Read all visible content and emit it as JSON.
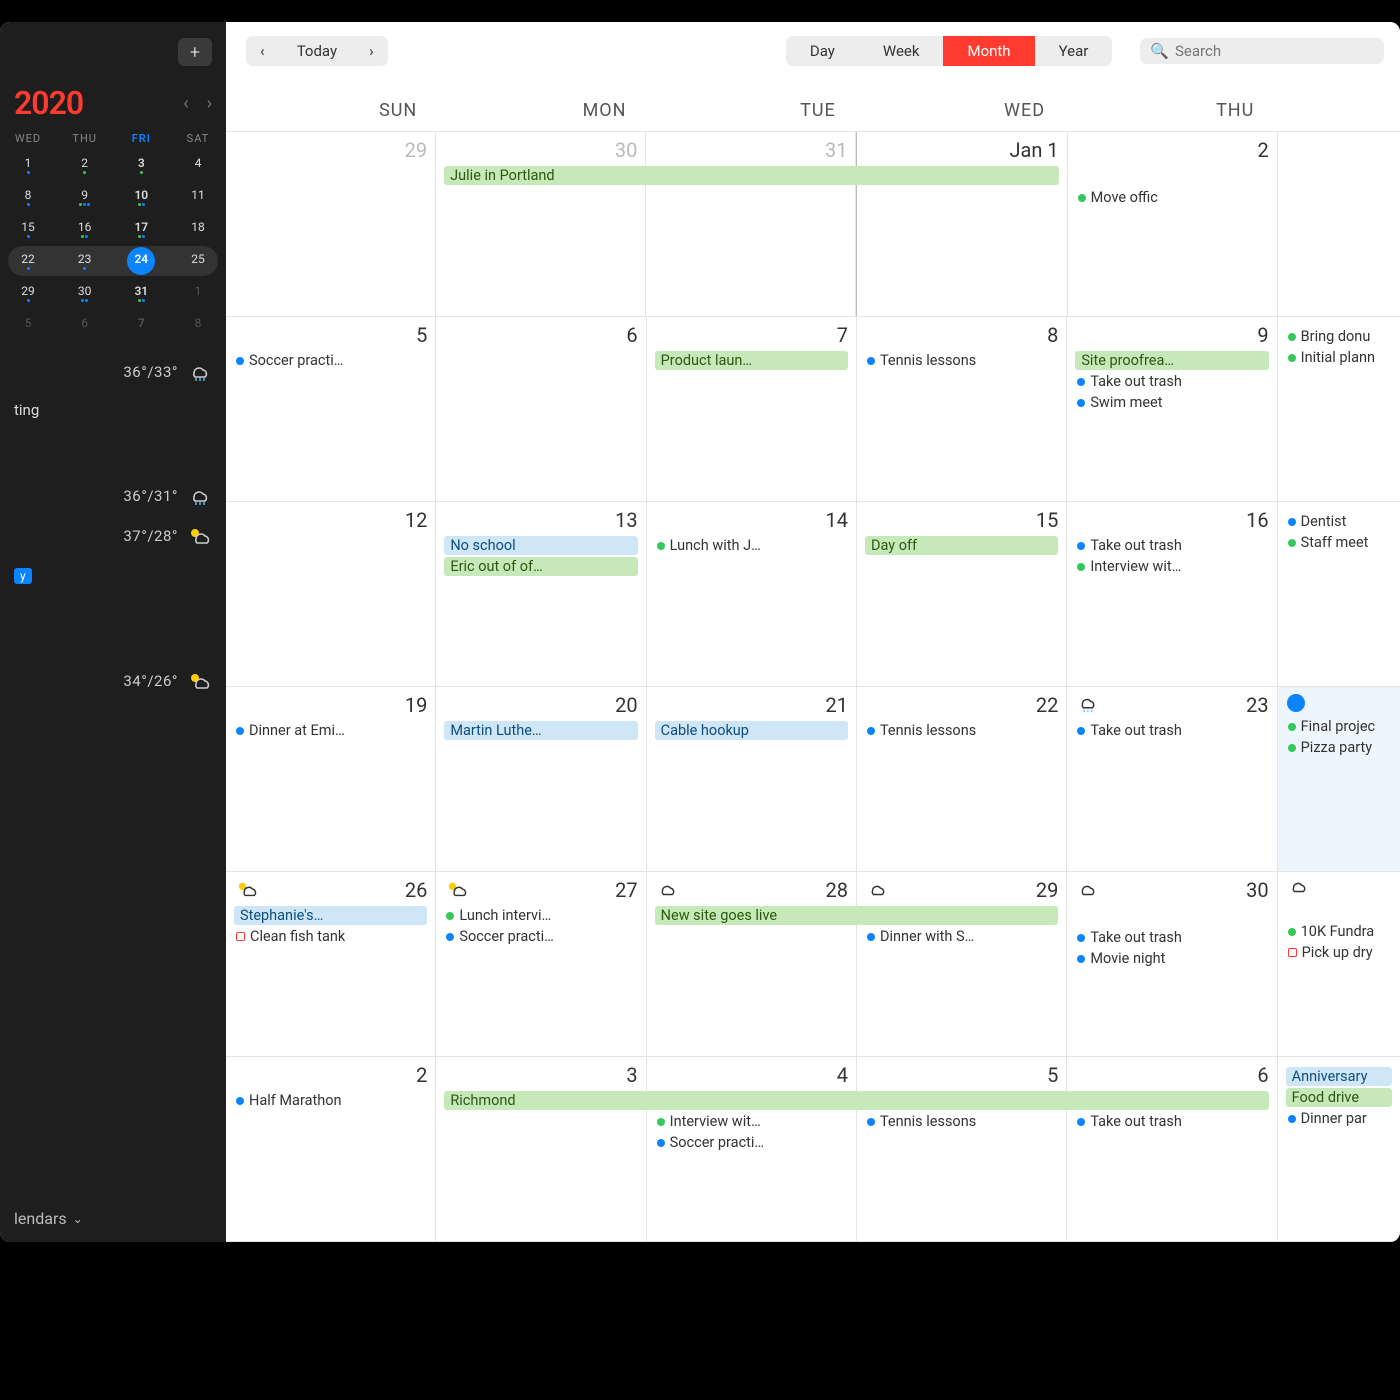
{
  "sidebar": {
    "add": "+",
    "year": "2020",
    "mini_dow": [
      "WED",
      "THU",
      "FRI",
      "SAT"
    ],
    "mini_rows": [
      [
        {
          "n": "1",
          "d": [
            "b"
          ]
        },
        {
          "n": "2",
          "d": [
            "g"
          ]
        },
        {
          "n": "3",
          "d": [
            "g"
          ]
        },
        {
          "n": "4",
          "d": []
        }
      ],
      [
        {
          "n": "8",
          "d": [
            "b"
          ]
        },
        {
          "n": "9",
          "d": [
            "g",
            "b",
            "b"
          ]
        },
        {
          "n": "10",
          "d": [
            "g",
            "b"
          ]
        },
        {
          "n": "11",
          "d": []
        }
      ],
      [
        {
          "n": "15",
          "d": [
            "b"
          ]
        },
        {
          "n": "16",
          "d": [
            "g",
            "b"
          ]
        },
        {
          "n": "17",
          "d": [
            "g",
            "b"
          ]
        },
        {
          "n": "18",
          "d": []
        }
      ],
      [
        {
          "n": "22",
          "d": [
            "b"
          ]
        },
        {
          "n": "23",
          "d": [
            "b"
          ]
        },
        {
          "n": "24",
          "d": [
            "b",
            "b"
          ],
          "today": true
        },
        {
          "n": "25",
          "d": []
        }
      ],
      [
        {
          "n": "29",
          "d": [
            "b"
          ]
        },
        {
          "n": "30",
          "d": [
            "b",
            "b"
          ]
        },
        {
          "n": "31",
          "d": [
            "g",
            "b"
          ]
        },
        {
          "n": "1",
          "d": [],
          "dim": true
        }
      ],
      [
        {
          "n": "5",
          "d": [],
          "dim": true
        },
        {
          "n": "6",
          "d": [],
          "dim": true
        },
        {
          "n": "7",
          "d": [],
          "dim": true
        },
        {
          "n": "8",
          "d": [],
          "dim": true
        }
      ]
    ],
    "weather1": "36°/33°",
    "word": "ting",
    "weather2": "36°/31°",
    "weather3": "37°/28°",
    "tag": "y",
    "weather4": "34°/26°",
    "calendars": "lendars"
  },
  "toolbar": {
    "prev": "‹",
    "next": "›",
    "today": "Today",
    "views": [
      "Day",
      "Week",
      "Month",
      "Year"
    ],
    "active": "Month",
    "search_placeholder": "Search"
  },
  "dow": [
    "SUN",
    "MON",
    "TUE",
    "WED",
    "THU"
  ],
  "weeks": [
    [
      {
        "num": "29",
        "dim": true,
        "rows": [
          null
        ]
      },
      {
        "num": "30",
        "dim": true,
        "rows": [
          {
            "type": "bar",
            "cls": "c-green-bar span",
            "text": "Julie in Portland"
          }
        ]
      },
      {
        "num": "31",
        "dim": true,
        "rows": [
          {
            "type": "bar",
            "cls": "c-green-bar cont span",
            "text": "."
          }
        ]
      },
      {
        "num": "Jan 1",
        "jan1": true,
        "rows": [
          {
            "type": "bar",
            "cls": "c-green-bar cont end",
            "text": "."
          }
        ]
      },
      {
        "num": "2",
        "rows": [
          null,
          {
            "type": "dot",
            "cls": "c-green",
            "text": "Move offic"
          }
        ]
      },
      {
        "num": "",
        "cut": true
      }
    ],
    [
      {
        "num": "5",
        "rows": [
          {
            "type": "dot",
            "cls": "c-blue",
            "text": "Soccer practi…"
          }
        ]
      },
      {
        "num": "6",
        "rows": [
          null
        ]
      },
      {
        "num": "7",
        "rows": [
          {
            "type": "bar",
            "cls": "c-green-bar",
            "text": "Product laun…"
          }
        ]
      },
      {
        "num": "8",
        "rows": [
          {
            "type": "dot",
            "cls": "c-blue",
            "text": "Tennis lessons"
          }
        ]
      },
      {
        "num": "9",
        "rows": [
          {
            "type": "bar",
            "cls": "c-green-bar",
            "text": "Site proofrea…"
          },
          {
            "type": "dot",
            "cls": "c-blue",
            "text": "Take out trash"
          },
          {
            "type": "dot",
            "cls": "c-blue",
            "text": "Swim meet"
          }
        ]
      },
      {
        "num": "",
        "cut": true,
        "rows": [
          {
            "type": "dot",
            "cls": "c-green",
            "text": "Bring donu"
          },
          {
            "type": "dot",
            "cls": "c-green",
            "text": "Initial plann"
          }
        ]
      }
    ],
    [
      {
        "num": "12",
        "rows": [
          null
        ]
      },
      {
        "num": "13",
        "rows": [
          {
            "type": "bar",
            "cls": "c-blue-bar",
            "text": "No school"
          },
          {
            "type": "bar",
            "cls": "c-green-bar",
            "text": "Eric out of of…"
          }
        ]
      },
      {
        "num": "14",
        "rows": [
          {
            "type": "dot",
            "cls": "c-green",
            "text": "Lunch with J…"
          }
        ]
      },
      {
        "num": "15",
        "rows": [
          {
            "type": "bar",
            "cls": "c-green-bar",
            "text": "Day off"
          }
        ]
      },
      {
        "num": "16",
        "rows": [
          {
            "type": "dot",
            "cls": "c-blue",
            "text": "Take out trash"
          },
          {
            "type": "dot",
            "cls": "c-green",
            "text": "Interview wit…"
          }
        ]
      },
      {
        "num": "",
        "cut": true,
        "rows": [
          {
            "type": "dot",
            "cls": "c-blue",
            "text": "Dentist"
          },
          {
            "type": "dot",
            "cls": "c-green",
            "text": "Staff meet"
          }
        ]
      }
    ],
    [
      {
        "num": "19",
        "rows": [
          {
            "type": "dot",
            "cls": "c-blue",
            "text": "Dinner at Emi…"
          }
        ]
      },
      {
        "num": "20",
        "rows": [
          {
            "type": "bar",
            "cls": "c-blue-bar",
            "text": "Martin Luthe…"
          }
        ]
      },
      {
        "num": "21",
        "rows": [
          {
            "type": "bar",
            "cls": "c-blue-bar",
            "text": "Cable hookup"
          }
        ]
      },
      {
        "num": "22",
        "rows": [
          {
            "type": "dot",
            "cls": "c-blue",
            "text": "Tennis lessons"
          }
        ]
      },
      {
        "num": "23",
        "weather": "rain",
        "rows": [
          {
            "type": "dot",
            "cls": "c-blue",
            "text": "Take out trash"
          }
        ]
      },
      {
        "num": "",
        "cut": true,
        "today": true,
        "weather": "dot",
        "rows": [
          {
            "type": "dot",
            "cls": "c-green",
            "text": "Final projec"
          },
          {
            "type": "dot",
            "cls": "c-green",
            "text": "Pizza party"
          }
        ]
      }
    ],
    [
      {
        "num": "26",
        "weather": "partsun",
        "rows": [
          {
            "type": "bar",
            "cls": "c-blue-bar",
            "text": "Stephanie's…"
          },
          {
            "type": "sq",
            "cls": "c-red",
            "text": "Clean fish tank"
          }
        ]
      },
      {
        "num": "27",
        "weather": "partsun",
        "rows": [
          {
            "type": "dot",
            "cls": "c-green",
            "text": "Lunch intervi…"
          },
          {
            "type": "dot",
            "cls": "c-blue",
            "text": "Soccer practi…"
          }
        ]
      },
      {
        "num": "28",
        "weather": "cloud",
        "rows": [
          {
            "type": "bar",
            "cls": "c-green-bar span",
            "text": "New site goes live"
          }
        ]
      },
      {
        "num": "29",
        "weather": "cloud",
        "rows": [
          {
            "type": "bar",
            "cls": "c-green-bar cont end",
            "text": "."
          },
          {
            "type": "dot",
            "cls": "c-blue",
            "text": "Dinner with S…"
          }
        ]
      },
      {
        "num": "30",
        "weather": "cloud",
        "rows": [
          null,
          {
            "type": "dot",
            "cls": "c-blue",
            "text": "Take out trash"
          },
          {
            "type": "dot",
            "cls": "c-blue",
            "text": "Movie night"
          }
        ]
      },
      {
        "num": "",
        "cut": true,
        "weather": "cloud",
        "rows": [
          null,
          {
            "type": "dot",
            "cls": "c-green",
            "text": "10K Fundra"
          },
          {
            "type": "sq",
            "cls": "c-red",
            "text": "Pick up dry"
          }
        ]
      }
    ],
    [
      {
        "num": "2",
        "rows": [
          {
            "type": "dot",
            "cls": "c-blue",
            "text": "Half Marathon"
          }
        ]
      },
      {
        "num": "3",
        "rows": [
          {
            "type": "bar",
            "cls": "c-green-bar span",
            "text": "Richmond"
          }
        ]
      },
      {
        "num": "4",
        "rows": [
          {
            "type": "bar",
            "cls": "c-green-bar cont span",
            "text": "."
          },
          {
            "type": "dot",
            "cls": "c-green",
            "text": "Interview wit…"
          },
          {
            "type": "dot",
            "cls": "c-blue",
            "text": "Soccer practi…"
          }
        ]
      },
      {
        "num": "5",
        "rows": [
          {
            "type": "bar",
            "cls": "c-green-bar cont span",
            "text": "."
          },
          {
            "type": "dot",
            "cls": "c-blue",
            "text": "Tennis lessons"
          }
        ]
      },
      {
        "num": "6",
        "rows": [
          {
            "type": "bar",
            "cls": "c-green-bar cont end",
            "text": "."
          },
          {
            "type": "dot",
            "cls": "c-blue",
            "text": "Take out trash"
          }
        ]
      },
      {
        "num": "",
        "cut": true,
        "rows": [
          {
            "type": "bar",
            "cls": "c-blue-bar",
            "text": "Anniversary"
          },
          {
            "type": "bar",
            "cls": "c-green-bar",
            "text": "Food drive"
          },
          {
            "type": "dot",
            "cls": "c-blue",
            "text": "Dinner par"
          }
        ]
      }
    ]
  ]
}
